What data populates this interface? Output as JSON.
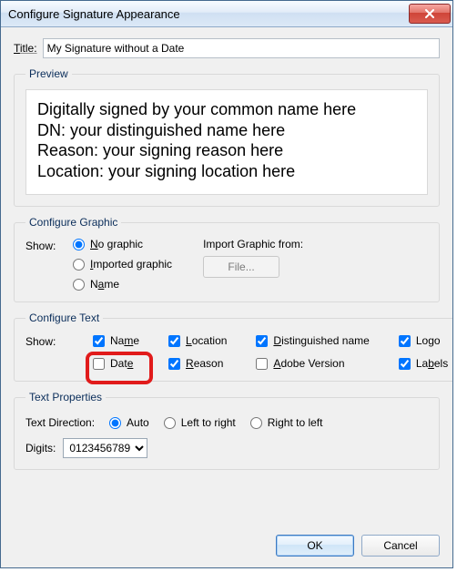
{
  "window": {
    "title": "Configure Signature Appearance"
  },
  "title": {
    "label": "Title:",
    "value": "My Signature without a Date"
  },
  "preview": {
    "legend": "Preview",
    "lines": {
      "l1": "Digitally signed by your common name here",
      "l2": "DN: your distinguished name here",
      "l3": "Reason: your signing reason here",
      "l4": "Location: your signing location here"
    }
  },
  "graphic": {
    "legend": "Configure Graphic",
    "show_label": "Show:",
    "options": {
      "no_graphic": "No graphic",
      "imported": "Imported graphic",
      "name": "Name"
    },
    "import_label": "Import Graphic from:",
    "file_button": "File...",
    "selected": "no_graphic"
  },
  "text": {
    "legend": "Configure Text",
    "show_label": "Show:",
    "items": {
      "name": {
        "label": "Name",
        "checked": true
      },
      "location": {
        "label": "Location",
        "checked": true
      },
      "dn": {
        "label": "Distinguished name",
        "checked": true
      },
      "logo": {
        "label": "Logo",
        "checked": true
      },
      "date": {
        "label": "Date",
        "checked": false
      },
      "reason": {
        "label": "Reason",
        "checked": true
      },
      "adobe": {
        "label": "Adobe Version",
        "checked": false
      },
      "labels": {
        "label": "Labels",
        "checked": true
      }
    }
  },
  "props": {
    "legend": "Text Properties",
    "direction_label": "Text Direction:",
    "direction": {
      "auto": "Auto",
      "ltr": "Left to right",
      "rtl": "Right to left",
      "selected": "auto"
    },
    "digits_label": "Digits:",
    "digits_value": "0123456789"
  },
  "buttons": {
    "ok": "OK",
    "cancel": "Cancel"
  }
}
